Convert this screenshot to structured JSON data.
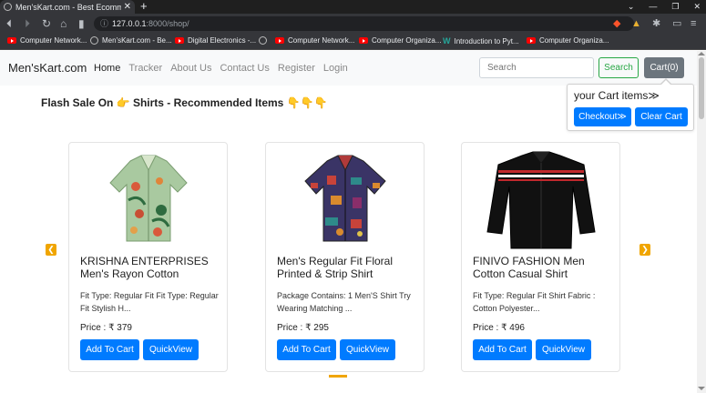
{
  "browser": {
    "tab_title": "Men'sKart.com - Best Ecommerce",
    "new_tab": "+",
    "url_host": "127.0.0.1",
    "url_path": ":8000/shop/",
    "window_controls": [
      "⌄",
      "—",
      "❐",
      "✕"
    ],
    "bookmarks": [
      {
        "label": "Computer Network...",
        "icon": "youtube-icon"
      },
      {
        "label": "Men'sKart.com - Be...",
        "icon": "globe-icon"
      },
      {
        "label": "Digital Electronics -...",
        "icon": "youtube-icon"
      },
      {
        "label": "",
        "icon": "globe-icon"
      },
      {
        "label": "Computer Network...",
        "icon": "youtube-icon"
      },
      {
        "label": "Computer Organiza...",
        "icon": "youtube-icon"
      },
      {
        "label": "Introduction to Pyt...",
        "icon": "w-icon"
      },
      {
        "label": "Computer Organiza...",
        "icon": "youtube-icon"
      }
    ]
  },
  "navbar": {
    "brand": "Men'sKart.com",
    "links": [
      "Home",
      "Tracker",
      "About Us",
      "Contact Us",
      "Register",
      "Login"
    ],
    "active_link": "Home",
    "search_placeholder": "Search",
    "search_button": "Search",
    "cart_button": "Cart(0)"
  },
  "cart_popover": {
    "title": "your Cart items≫",
    "checkout": "Checkout≫",
    "clear": "Clear Cart"
  },
  "heading": "Flash Sale On 👉 Shirts - Recommended Items 👇👇👇",
  "products": [
    {
      "title": "KRISHNA ENTERPRISES Men's Rayon Cotton",
      "desc": "Fit Type: Regular Fit Fit Type: Regular Fit Stylish H...",
      "price": "Price : ₹ 379",
      "add": "Add To Cart",
      "view": "QuickView"
    },
    {
      "title": "Men's Regular Fit Floral Printed & Strip Shirt",
      "desc": "Package Contains: 1 Men'S Shirt Try Wearing Matching ...",
      "price": "Price : ₹ 295",
      "add": "Add To Cart",
      "view": "QuickView"
    },
    {
      "title": "FINIVO FASHION Men Cotton Casual Shirt",
      "desc": "Fit Type: Regular Fit Shirt Fabric : Cotton Polyester...",
      "price": "Price : ₹ 496",
      "add": "Add To Cart",
      "view": "QuickView"
    }
  ],
  "colors": {
    "primary": "#007bff",
    "success": "#28a745",
    "secondary": "#6c757d",
    "carousel_accent": "#f0a500"
  }
}
